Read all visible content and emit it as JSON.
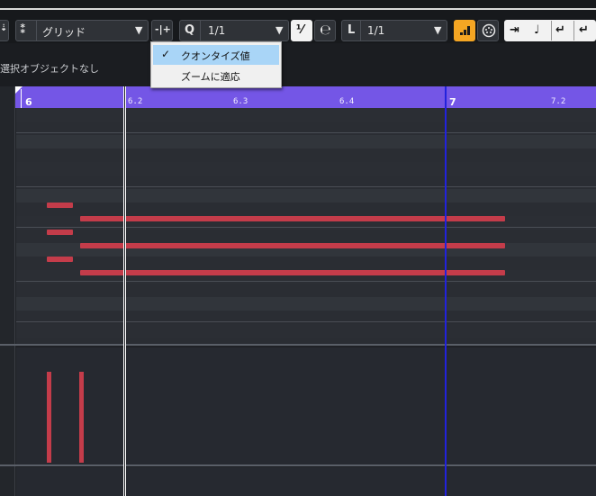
{
  "toolbar": {
    "snap_type_value": "グリッド",
    "quantize_label": "Q",
    "quantize_value": "1/1",
    "length_label": "L",
    "length_value": "1/1"
  },
  "info_line": {
    "text": "選択オブジェクトなし"
  },
  "ruler": {
    "major": [
      {
        "label": "6"
      },
      {
        "label": "7"
      }
    ],
    "minor": [
      {
        "label": "6.2"
      },
      {
        "label": "6.3"
      },
      {
        "label": "6.4"
      },
      {
        "label": "7.2"
      }
    ]
  },
  "dropdown": {
    "items": [
      {
        "label": "クオンタイズ値",
        "checked": true
      },
      {
        "label": "ズームに適応",
        "checked": false
      }
    ]
  },
  "colors": {
    "ruler": "#7456e6",
    "note": "#c43c4a",
    "playhead": "#2222dd",
    "active_button": "#f5a623",
    "dropdown_highlight": "#a9d5f7"
  }
}
